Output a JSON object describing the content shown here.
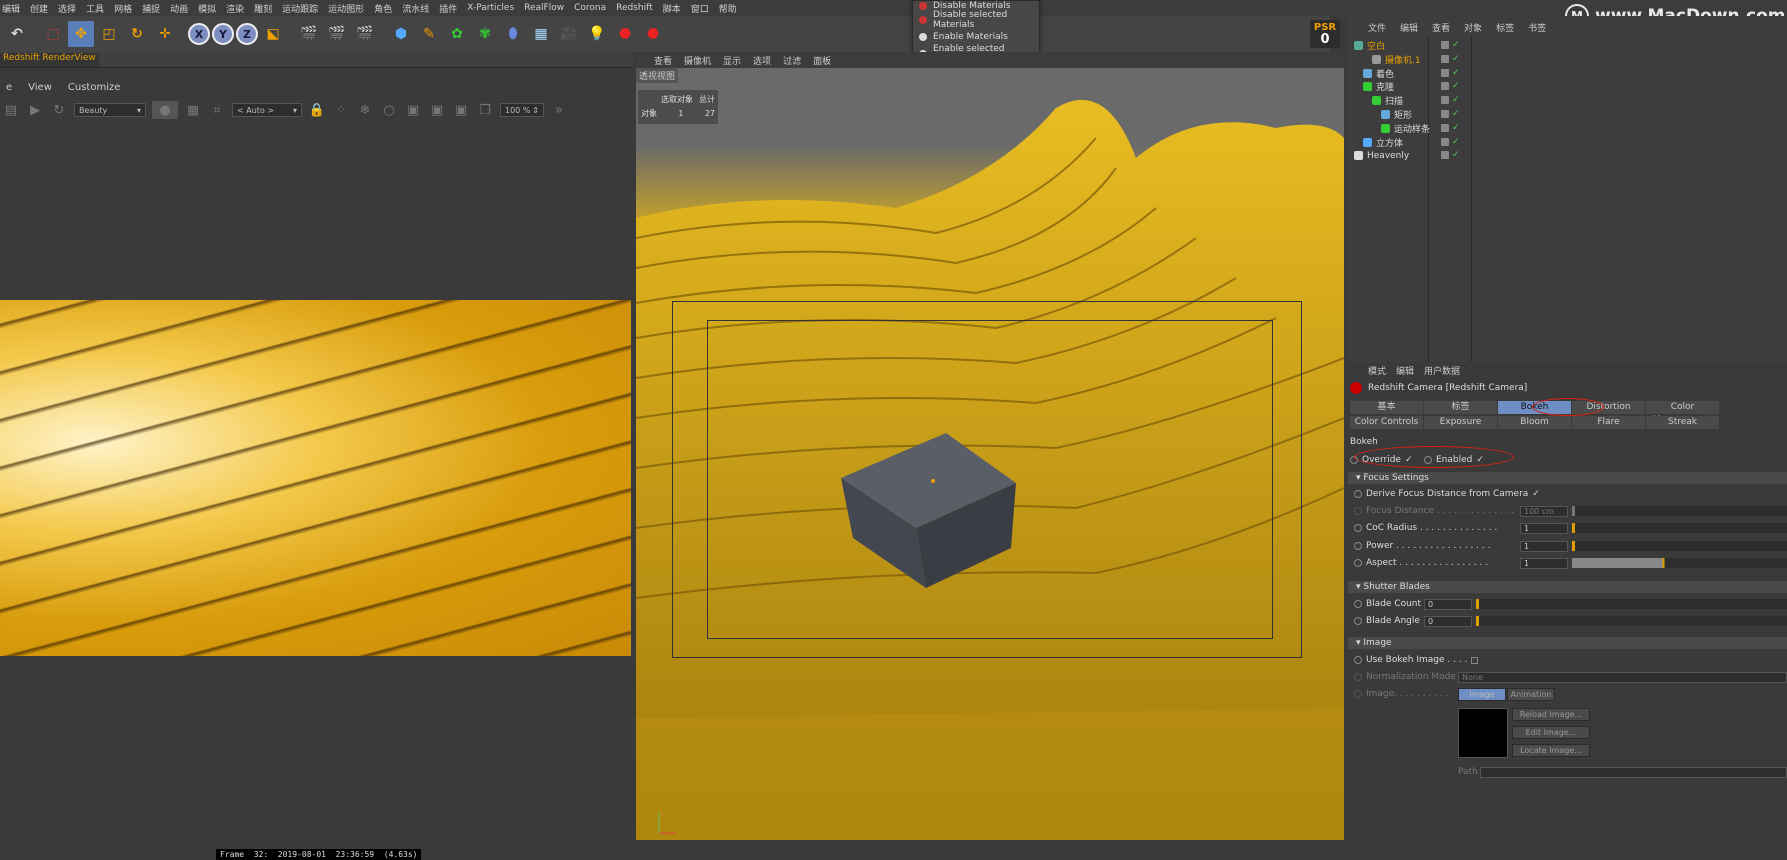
{
  "menubar": [
    "编辑",
    "创建",
    "选择",
    "工具",
    "网格",
    "捕捉",
    "动画",
    "模拟",
    "渲染",
    "雕刻",
    "运动跟踪",
    "运动图形",
    "角色",
    "流水线",
    "插件",
    "X-Particles",
    "RealFlow",
    "Corona",
    "Redshift",
    "脚本",
    "窗口",
    "帮助"
  ],
  "dropdown": {
    "items": [
      {
        "label": "Disable Materials",
        "color": "#c33"
      },
      {
        "label": "Disable selected Materials",
        "color": "#c33"
      },
      {
        "label": "Enable Materials",
        "color": "#ddd"
      },
      {
        "label": "Enable selected Materials",
        "color": "#ddd"
      }
    ]
  },
  "psr": {
    "label": "PSR",
    "value": "0"
  },
  "watermark": {
    "logo": "M",
    "text": "www.MacDown.com"
  },
  "renderview": {
    "tab": "Redshift RenderView",
    "menu": [
      "e",
      "View",
      "Customize"
    ],
    "aov": "Beauty",
    "aov_channel": "< Auto >",
    "zoom": "100 %",
    "frame_info": "Frame  32:  2019-08-01  23:36:59  (4.63s)"
  },
  "viewport": {
    "menu": [
      "查看",
      "摄像机",
      "显示",
      "选项",
      "过滤",
      "面板"
    ],
    "label": "透视视图",
    "stats": {
      "header_sel": "选取对象",
      "header_total": "总计",
      "row_label": "对象",
      "selected": "1",
      "total": "27"
    }
  },
  "object_manager": {
    "menu": [
      "文件",
      "编辑",
      "查看",
      "对象",
      "标签",
      "书签"
    ],
    "rows": [
      {
        "label": "空白",
        "indent": 0,
        "color": "#e8a200",
        "icon": "null-icon"
      },
      {
        "label": "摄像机.1",
        "indent": 2,
        "color": "#e8a200",
        "icon": "camera-icon"
      },
      {
        "label": "着色",
        "indent": 1,
        "color": "#ddd",
        "icon": "shader-icon"
      },
      {
        "label": "克隆",
        "indent": 1,
        "color": "#ddd",
        "icon": "cloner-icon"
      },
      {
        "label": "扫描",
        "indent": 2,
        "color": "#ddd",
        "icon": "sweep-icon"
      },
      {
        "label": "矩形",
        "indent": 3,
        "color": "#ddd",
        "icon": "rectangle-icon"
      },
      {
        "label": "运动样条",
        "indent": 3,
        "color": "#ddd",
        "icon": "mospline-icon"
      },
      {
        "label": "立方体",
        "indent": 1,
        "color": "#ddd",
        "icon": "cube-icon"
      },
      {
        "label": "Heavenly",
        "indent": 0,
        "color": "#ddd",
        "icon": "light-icon"
      }
    ]
  },
  "attribute_manager": {
    "menu": [
      "模式",
      "编辑",
      "用户数据"
    ],
    "title": "Redshift Camera [Redshift Camera]",
    "tabs_row1": [
      "基本",
      "标签",
      "Bokeh",
      "Distortion",
      "Color Management"
    ],
    "tabs_row2": [
      "Color Controls",
      "Exposure",
      "Bloom",
      "Flare",
      "Streak"
    ],
    "active_tab": "Bokeh",
    "section_title": "Bokeh",
    "override_label": "Override",
    "enabled_label": "Enabled",
    "focus_settings": "Focus Settings",
    "derive_focus": "Derive Focus Distance from Camera",
    "focus_distance_label": "Focus Distance . . . . . . . . . . . . . .",
    "focus_distance": "100 cm",
    "coc_label": "CoC Radius . . . . . . . . . . . . . .",
    "coc": "1",
    "power_label": "Power . . . . . . . . . . . . . . . . .",
    "power": "1",
    "aspect_label": "Aspect . . . . . . . . . . . . . . . .",
    "aspect": "1",
    "shutter_blades": "Shutter Blades",
    "blade_count_label": "Blade Count",
    "blade_count": "0",
    "blade_angle_label": "Blade Angle",
    "blade_angle": "0",
    "image_section": "Image",
    "use_bokeh_label": "Use Bokeh Image . . . .",
    "norm_mode_label": "Normalization Mode",
    "norm_mode": "None",
    "image_label": "Image. . . . . . . . . .",
    "image_tab": "Image",
    "animation_tab": "Animation",
    "reload": "Reload Image...",
    "edit": "Edit Image...",
    "locate": "Locate Image...",
    "path_label": "Path"
  }
}
